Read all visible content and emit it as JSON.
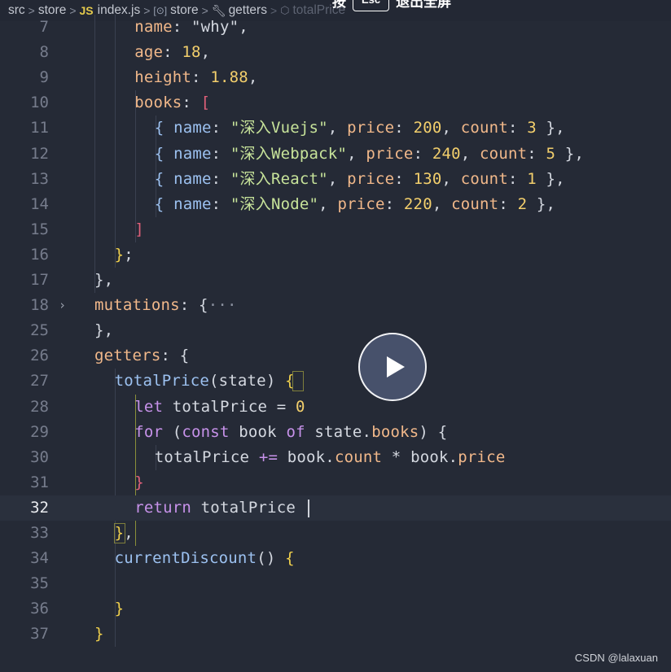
{
  "breadcrumb": {
    "items": [
      "src",
      "store",
      "index.js",
      "store",
      "getters",
      "totalPrice"
    ],
    "separator": ">"
  },
  "overlay": {
    "prefix": "按",
    "key": "Esc",
    "suffix": "退出全屏"
  },
  "editor": {
    "current_line": "32",
    "lines": [
      {
        "num": "7",
        "indent": 3,
        "segments": [
          [
            "name",
            "#f1b88a"
          ],
          [
            ": ",
            "#d4d8e0"
          ],
          [
            "\"why\"",
            "#d4d8e0"
          ],
          [
            ",",
            "#d4d8e0"
          ]
        ]
      },
      {
        "num": "8",
        "indent": 3,
        "segments": [
          [
            "age",
            "#f1b88a"
          ],
          [
            ": ",
            "#d4d8e0"
          ],
          [
            "18",
            "#f3cf6c"
          ],
          [
            ",",
            "#d4d8e0"
          ]
        ]
      },
      {
        "num": "9",
        "indent": 3,
        "segments": [
          [
            "height",
            "#f1b88a"
          ],
          [
            ": ",
            "#d4d8e0"
          ],
          [
            "1.88",
            "#f3cf6c"
          ],
          [
            ",",
            "#d4d8e0"
          ]
        ]
      },
      {
        "num": "10",
        "indent": 3,
        "segments": [
          [
            "books",
            "#f1b88a"
          ],
          [
            ": ",
            "#d4d8e0"
          ],
          [
            "[",
            "#e0607a"
          ]
        ]
      },
      {
        "num": "11",
        "indent": 4,
        "segments": [
          [
            "{ ",
            "#9cc1f0"
          ],
          [
            "name",
            "#9cc1f0"
          ],
          [
            ": ",
            "#d4d8e0"
          ],
          [
            "\"深入Vuejs\"",
            "#c7e39a"
          ],
          [
            ", ",
            "#d4d8e0"
          ],
          [
            "price",
            "#f1b88a"
          ],
          [
            ": ",
            "#d4d8e0"
          ],
          [
            "200",
            "#f3cf6c"
          ],
          [
            ", ",
            "#d4d8e0"
          ],
          [
            "count",
            "#f1b88a"
          ],
          [
            ": ",
            "#d4d8e0"
          ],
          [
            "3",
            "#f3cf6c"
          ],
          [
            " },",
            "#d4d8e0"
          ]
        ]
      },
      {
        "num": "12",
        "indent": 4,
        "segments": [
          [
            "{ ",
            "#9cc1f0"
          ],
          [
            "name",
            "#9cc1f0"
          ],
          [
            ": ",
            "#d4d8e0"
          ],
          [
            "\"深入Webpack\"",
            "#c7e39a"
          ],
          [
            ", ",
            "#d4d8e0"
          ],
          [
            "price",
            "#f1b88a"
          ],
          [
            ": ",
            "#d4d8e0"
          ],
          [
            "240",
            "#f3cf6c"
          ],
          [
            ", ",
            "#d4d8e0"
          ],
          [
            "count",
            "#f1b88a"
          ],
          [
            ": ",
            "#d4d8e0"
          ],
          [
            "5",
            "#f3cf6c"
          ],
          [
            " },",
            "#d4d8e0"
          ]
        ]
      },
      {
        "num": "13",
        "indent": 4,
        "segments": [
          [
            "{ ",
            "#9cc1f0"
          ],
          [
            "name",
            "#9cc1f0"
          ],
          [
            ": ",
            "#d4d8e0"
          ],
          [
            "\"深入React\"",
            "#c7e39a"
          ],
          [
            ", ",
            "#d4d8e0"
          ],
          [
            "price",
            "#f1b88a"
          ],
          [
            ": ",
            "#d4d8e0"
          ],
          [
            "130",
            "#f3cf6c"
          ],
          [
            ", ",
            "#d4d8e0"
          ],
          [
            "count",
            "#f1b88a"
          ],
          [
            ": ",
            "#d4d8e0"
          ],
          [
            "1",
            "#f3cf6c"
          ],
          [
            " },",
            "#d4d8e0"
          ]
        ]
      },
      {
        "num": "14",
        "indent": 4,
        "segments": [
          [
            "{ ",
            "#9cc1f0"
          ],
          [
            "name",
            "#9cc1f0"
          ],
          [
            ": ",
            "#d4d8e0"
          ],
          [
            "\"深入Node\"",
            "#c7e39a"
          ],
          [
            ", ",
            "#d4d8e0"
          ],
          [
            "price",
            "#f1b88a"
          ],
          [
            ": ",
            "#d4d8e0"
          ],
          [
            "220",
            "#f3cf6c"
          ],
          [
            ", ",
            "#d4d8e0"
          ],
          [
            "count",
            "#f1b88a"
          ],
          [
            ": ",
            "#d4d8e0"
          ],
          [
            "2",
            "#f3cf6c"
          ],
          [
            " },",
            "#d4d8e0"
          ]
        ]
      },
      {
        "num": "15",
        "indent": 3,
        "segments": [
          [
            "]",
            "#e0607a"
          ]
        ]
      },
      {
        "num": "16",
        "indent": 2,
        "segments": [
          [
            "}",
            "#f0d04c"
          ],
          [
            ";",
            "#d4d8e0"
          ]
        ]
      },
      {
        "num": "17",
        "indent": 1,
        "segments": [
          [
            "}",
            "#d4d8e0"
          ],
          [
            ",",
            "#d4d8e0"
          ]
        ]
      },
      {
        "num": "18",
        "indent": 1,
        "fold": "›",
        "segments": [
          [
            "mutations",
            "#f1b88a"
          ],
          [
            ": ",
            "#d4d8e0"
          ],
          [
            "{",
            "#d4d8e0"
          ],
          [
            "···",
            "#8a909e"
          ]
        ]
      },
      {
        "num": "25",
        "indent": 1,
        "segments": [
          [
            "}",
            "#d4d8e0"
          ],
          [
            ",",
            "#d4d8e0"
          ]
        ]
      },
      {
        "num": "26",
        "indent": 1,
        "segments": [
          [
            "getters",
            "#f1b88a"
          ],
          [
            ": ",
            "#d4d8e0"
          ],
          [
            "{",
            "#d4d8e0"
          ]
        ]
      },
      {
        "num": "27",
        "indent": 2,
        "segments": [
          [
            "totalPrice",
            "#9cc1f0"
          ],
          [
            "(",
            "#d4d8e0"
          ],
          [
            "state",
            "#d4d8e0"
          ],
          [
            ") ",
            "#d4d8e0"
          ],
          [
            "{",
            "#f0d04c"
          ]
        ]
      },
      {
        "num": "28",
        "indent": 3,
        "segments": [
          [
            "let",
            "#c792ea"
          ],
          [
            " totalPrice ",
            "#d4d8e0"
          ],
          [
            "=",
            "#d4d8e0"
          ],
          [
            " 0",
            "#f3cf6c"
          ]
        ]
      },
      {
        "num": "29",
        "indent": 3,
        "segments": [
          [
            "for",
            "#c792ea"
          ],
          [
            " ",
            "#d4d8e0"
          ],
          [
            "(",
            "#d4d8e0"
          ],
          [
            "const",
            "#c792ea"
          ],
          [
            " book ",
            "#d4d8e0"
          ],
          [
            "of",
            "#c792ea"
          ],
          [
            " state.",
            "#d4d8e0"
          ],
          [
            "books",
            "#f1b88a"
          ],
          [
            ") ",
            "#d4d8e0"
          ],
          [
            "{",
            "#d4d8e0"
          ]
        ]
      },
      {
        "num": "30",
        "indent": 4,
        "segments": [
          [
            "totalPrice ",
            "#d4d8e0"
          ],
          [
            "+=",
            "#c792ea"
          ],
          [
            " book.",
            "#d4d8e0"
          ],
          [
            "count",
            "#f1b88a"
          ],
          [
            " * ",
            "#d4d8e0"
          ],
          [
            "book.",
            "#d4d8e0"
          ],
          [
            "price",
            "#f1b88a"
          ]
        ]
      },
      {
        "num": "31",
        "indent": 3,
        "segments": [
          [
            "}",
            "#e0607a"
          ]
        ]
      },
      {
        "num": "32",
        "indent": 3,
        "segments": [
          [
            "return",
            "#c792ea"
          ],
          [
            " totalPrice",
            "#d4d8e0"
          ]
        ]
      },
      {
        "num": "33",
        "indent": 2,
        "segments": [
          [
            "}",
            "#f0d04c"
          ],
          [
            ",",
            "#d4d8e0"
          ]
        ]
      },
      {
        "num": "34",
        "indent": 2,
        "segments": [
          [
            "currentDiscount",
            "#9cc1f0"
          ],
          [
            "() ",
            "#d4d8e0"
          ],
          [
            "{",
            "#f0d04c"
          ]
        ]
      },
      {
        "num": "35",
        "indent": 2,
        "segments": []
      },
      {
        "num": "36",
        "indent": 2,
        "segments": [
          [
            "}",
            "#f0d04c"
          ]
        ]
      },
      {
        "num": "37",
        "indent": 1,
        "segments": [
          [
            "}",
            "#f0d04c"
          ]
        ]
      }
    ]
  },
  "video": {
    "play_icon": "play-icon"
  },
  "watermark": "CSDN @lalaxuan"
}
